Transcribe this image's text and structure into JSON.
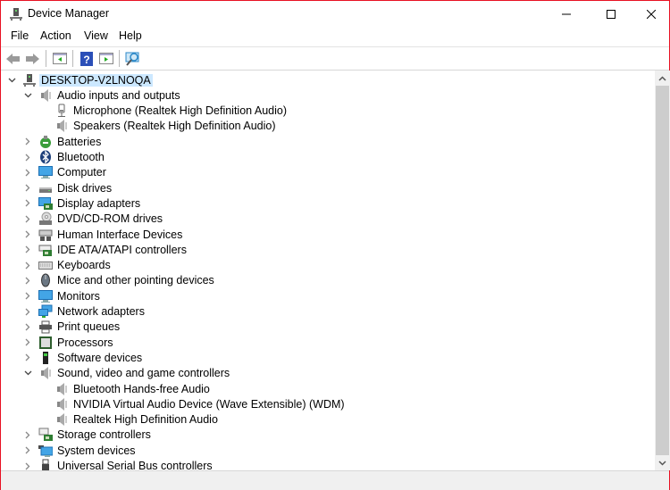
{
  "window": {
    "title": "Device Manager",
    "icons": {
      "app": "device-manager-icon",
      "minimize": "minimize-icon",
      "maximize": "maximize-icon",
      "close": "close-icon"
    }
  },
  "menu": [
    "File",
    "Action",
    "View",
    "Help"
  ],
  "toolbar": {
    "buttons": [
      "back-arrow-icon",
      "forward-arrow-icon",
      "show-hide-console-tree-icon",
      "help-icon",
      "properties-pane-icon",
      "scan-hardware-icon"
    ]
  },
  "tree": {
    "root": {
      "label": "DESKTOP-V2LNOQA",
      "icon": "computer-tower-icon",
      "expanded": true,
      "selected": true
    },
    "categories": [
      {
        "label": "Audio inputs and outputs",
        "icon": "speaker-icon",
        "expanded": true,
        "children": [
          {
            "label": "Microphone (Realtek High Definition Audio)",
            "icon": "microphone-icon"
          },
          {
            "label": "Speakers (Realtek High Definition Audio)",
            "icon": "speaker-icon"
          }
        ]
      },
      {
        "label": "Batteries",
        "icon": "battery-icon",
        "expanded": false
      },
      {
        "label": "Bluetooth",
        "icon": "bluetooth-icon",
        "expanded": false
      },
      {
        "label": "Computer",
        "icon": "monitor-icon",
        "expanded": false
      },
      {
        "label": "Disk drives",
        "icon": "disk-drive-icon",
        "expanded": false
      },
      {
        "label": "Display adapters",
        "icon": "display-adapter-icon",
        "expanded": false
      },
      {
        "label": "DVD/CD-ROM drives",
        "icon": "dvd-drive-icon",
        "expanded": false
      },
      {
        "label": "Human Interface Devices",
        "icon": "hid-icon",
        "expanded": false
      },
      {
        "label": "IDE ATA/ATAPI controllers",
        "icon": "ide-controller-icon",
        "expanded": false
      },
      {
        "label": "Keyboards",
        "icon": "keyboard-icon",
        "expanded": false
      },
      {
        "label": "Mice and other pointing devices",
        "icon": "mouse-icon",
        "expanded": false
      },
      {
        "label": "Monitors",
        "icon": "monitor-icon",
        "expanded": false
      },
      {
        "label": "Network adapters",
        "icon": "network-adapter-icon",
        "expanded": false
      },
      {
        "label": "Print queues",
        "icon": "printer-icon",
        "expanded": false
      },
      {
        "label": "Processors",
        "icon": "processor-icon",
        "expanded": false
      },
      {
        "label": "Software devices",
        "icon": "software-device-icon",
        "expanded": false
      },
      {
        "label": "Sound, video and game controllers",
        "icon": "speaker-icon",
        "expanded": true,
        "children": [
          {
            "label": "Bluetooth Hands-free Audio",
            "icon": "speaker-icon"
          },
          {
            "label": "NVIDIA Virtual Audio Device (Wave Extensible) (WDM)",
            "icon": "speaker-icon"
          },
          {
            "label": "Realtek High Definition Audio",
            "icon": "speaker-icon"
          }
        ]
      },
      {
        "label": "Storage controllers",
        "icon": "storage-controller-icon",
        "expanded": false
      },
      {
        "label": "System devices",
        "icon": "system-devices-icon",
        "expanded": false
      },
      {
        "label": "Universal Serial Bus controllers",
        "icon": "usb-icon",
        "expanded": false
      }
    ]
  },
  "colors": {
    "window_border": "#e81123",
    "selection": "#cce8ff",
    "scroll_thumb": "#cdcdcd"
  }
}
